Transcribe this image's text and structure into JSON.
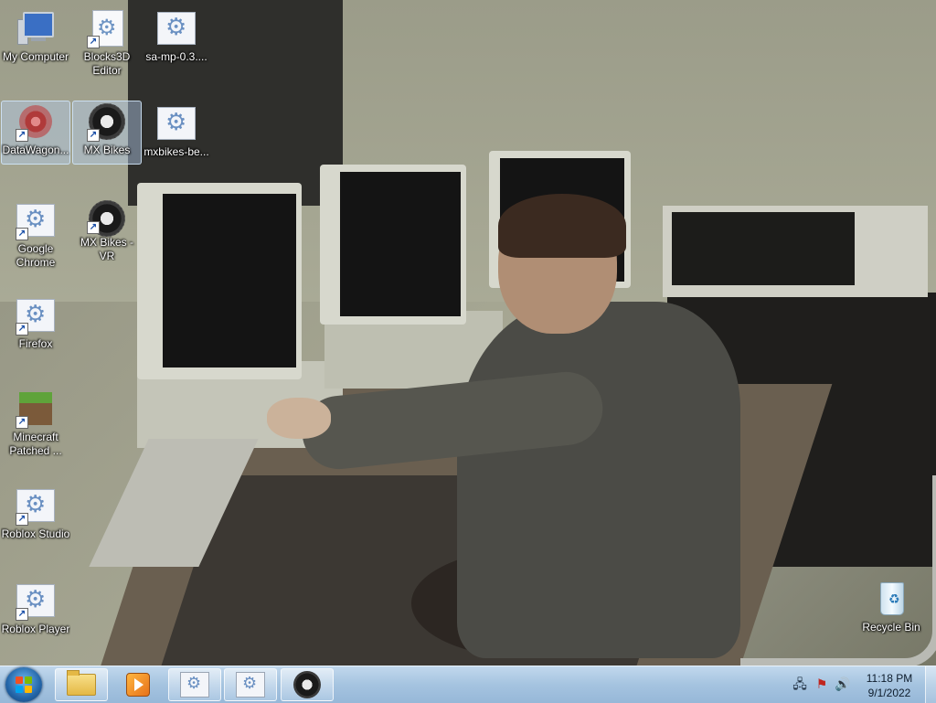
{
  "desktop": {
    "icons": [
      {
        "label": "My Computer",
        "icon": "computer-icon",
        "selected": false
      },
      {
        "label": "Blocks3D\nEditor",
        "icon": "application-gear-icon",
        "shortcut": true
      },
      {
        "label": "sa-mp-0.3....",
        "icon": "application-gear-icon",
        "shortcut": false
      },
      {
        "label": "DataWagon...",
        "icon": "datawagon-icon",
        "shortcut": true,
        "selected": true
      },
      {
        "label": "MX Bikes",
        "icon": "tire-icon",
        "shortcut": true,
        "selected": true
      },
      {
        "label": "mxbikes-be...",
        "icon": "application-gear-icon",
        "shortcut": false
      },
      {
        "label": "Google\nChrome",
        "icon": "application-gear-icon",
        "shortcut": true
      },
      {
        "label": "MX Bikes - VR",
        "icon": "tire-icon",
        "shortcut": true
      },
      {
        "label": "Firefox",
        "icon": "application-gear-icon",
        "shortcut": true
      },
      {
        "label": "Minecraft\nPatched ...",
        "icon": "minecraft-block-icon",
        "shortcut": true
      },
      {
        "label": "Roblox Studio",
        "icon": "application-gear-icon",
        "shortcut": true
      },
      {
        "label": "Roblox Player",
        "icon": "application-gear-icon",
        "shortcut": true
      },
      {
        "label": "Recycle Bin",
        "icon": "recycle-bin-icon",
        "shortcut": false
      }
    ]
  },
  "taskbar": {
    "start_icon": "windows-logo-icon",
    "pinned": [
      {
        "name": "windows-explorer",
        "icon": "folder-icon"
      },
      {
        "name": "media-player",
        "icon": "media-player-icon"
      },
      {
        "name": "application-1",
        "icon": "application-gear-icon"
      },
      {
        "name": "application-2",
        "icon": "application-gear-icon"
      },
      {
        "name": "mx-bikes",
        "icon": "tire-icon"
      }
    ],
    "tray": {
      "icons": [
        "network-icon",
        "action-center-flag-icon",
        "volume-icon"
      ]
    },
    "clock": {
      "time": "11:18 PM",
      "date": "9/1/2022"
    }
  },
  "colors": {
    "taskbar_top": "#bed6ec",
    "taskbar_bottom": "#91b4d6",
    "selection": "#b4cdeb",
    "label_text": "#ffffff"
  }
}
